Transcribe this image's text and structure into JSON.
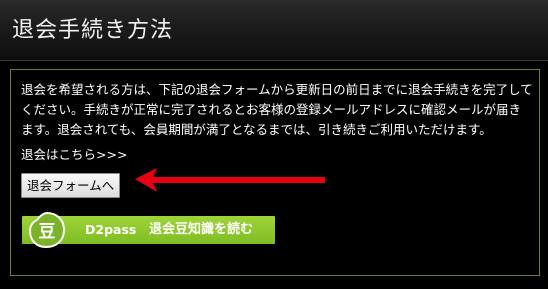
{
  "header": {
    "title": "退会手続き方法"
  },
  "content": {
    "paragraph": "退会を希望される方は、下記の退会フォームから更新日の前日までに退会手続きを完了してください。手続きが正常に完了されるとお客様の登録メールアドレスに確認メールが届きます。退会されても、会員期間が満了となるまでは、引き続きご利用いただけます。",
    "link_label": "退会はこちら>>>",
    "button_label": "退会フォームへ",
    "banner": {
      "icon_glyph": "豆",
      "brand": "D2pass",
      "label": "退会豆知識を読む"
    }
  },
  "colors": {
    "banner_green": "#8cc63f",
    "arrow_red": "#e60012",
    "box_border": "#6d7a3a"
  }
}
